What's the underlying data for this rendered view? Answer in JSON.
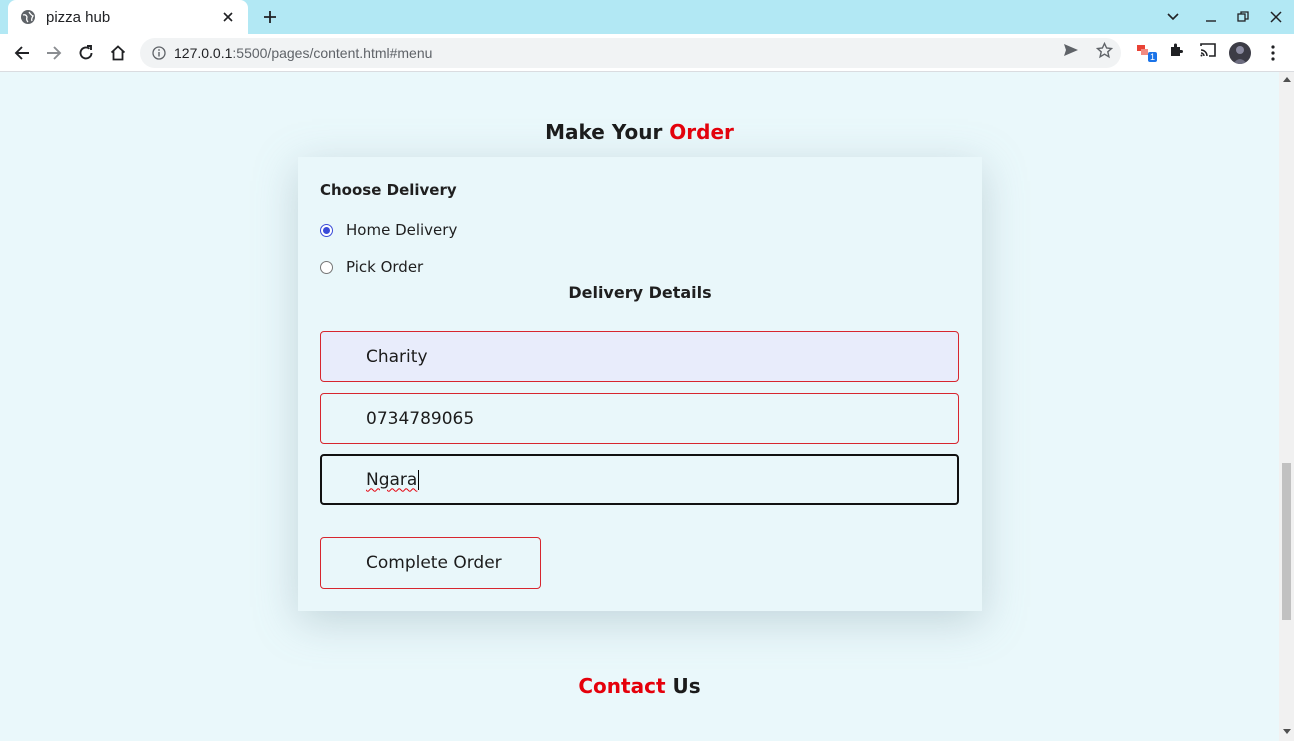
{
  "browser": {
    "tab_title": "pizza hub",
    "url_host": "127.0.0.1",
    "url_rest": ":5500/pages/content.html#menu",
    "extension_badge": "1"
  },
  "page": {
    "order_heading_prefix": "Make Your ",
    "order_heading_accent": "Order",
    "choose_delivery_label": "Choose Delivery",
    "delivery_options": [
      {
        "label": "Home Delivery",
        "selected": true
      },
      {
        "label": "Pick Order",
        "selected": false
      }
    ],
    "delivery_details_title": "Delivery Details",
    "fields": {
      "name_value": "Charity",
      "phone_value": "0734789065",
      "location_value": "Ngara"
    },
    "submit_label": "Complete Order",
    "contact_heading_accent": "Contact",
    "contact_heading_suffix": " Us"
  },
  "colors": {
    "accent_red": "#e5000b",
    "page_bg": "#eaf8fb",
    "tabstrip_bg": "#b2e8f4"
  }
}
